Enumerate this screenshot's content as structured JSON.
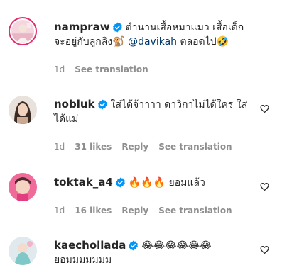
{
  "comments": [
    {
      "username": "nampraw",
      "verified": true,
      "text_before": "ตำนานเสื้อหมาแมว เสื้อเด็ก จะอยู่กับลูกลิง",
      "emoji_1": "🐒",
      "mention": "@davikah",
      "text_after": " ตลอดไป",
      "emoji_2": "🤣",
      "time": "1d",
      "likes": "",
      "see_translation": "See translation"
    },
    {
      "username": "nobluk",
      "verified": true,
      "text": "ใส่ได้จ้าาาา ดาวิกาไม่ได้ใคร ใส่ได้แม่",
      "time": "1d",
      "likes": "31 likes",
      "reply": "Reply",
      "see_translation": "See translation"
    },
    {
      "username": "toktak_a4",
      "verified": true,
      "emojis": [
        "🔥",
        "🔥",
        "🔥"
      ],
      "text": "ยอมแล้ว",
      "time": "1d",
      "likes": "16 likes",
      "reply": "Reply",
      "see_translation": "See translation"
    },
    {
      "username": "kaechollada",
      "verified": true,
      "emojis": [
        "😂",
        "😂",
        "😂",
        "😂",
        "😂",
        "😂"
      ],
      "text": "ยอมมมมมมม"
    }
  ],
  "colors": {
    "verified": "#0095f6",
    "secondary_text": "#8e8e8e",
    "link": "#00376b",
    "story_ring": "#e1306c"
  },
  "icons": {
    "heart": "heart-outline-icon",
    "verified": "verified-badge-icon"
  }
}
